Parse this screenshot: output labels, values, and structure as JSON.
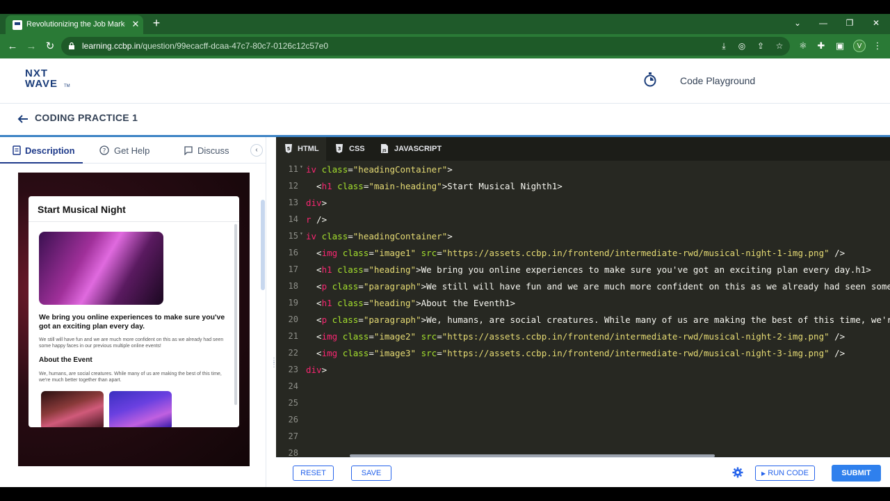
{
  "browser": {
    "tab_title": "Revolutionizing the Job Market |",
    "tab_close": "✕",
    "new_tab": "+",
    "url_host": "learning.ccbp.in",
    "url_path": "/question/99ecacff-dcaa-47c7-80c7-0126c12c57e0",
    "profile_initial": "V",
    "accent": "#2a7a36"
  },
  "header": {
    "logo_line1": "NXT",
    "logo_line2": "WAVE",
    "logo_tm": "TM",
    "playground_label": "Code Playground"
  },
  "practice": {
    "title": "CODING PRACTICE 1"
  },
  "left_tabs": [
    {
      "label": "Description",
      "icon": "document-icon"
    },
    {
      "label": "Get Help",
      "icon": "help-circle-icon"
    },
    {
      "label": "Discuss",
      "icon": "chat-icon"
    }
  ],
  "preview": {
    "title": "Start Musical Night",
    "heading": "We bring you online experiences to make sure you've got an exciting plan every day.",
    "paragraph": "We still will have fun and we are much more confident on this as we already had seen some happy faces in our previous multiple online events!",
    "about_heading": "About the Event",
    "about_paragraph": "We, humans, are social creatures. While many of us are making the best of this time, we're much better together than apart."
  },
  "editor_tabs": [
    {
      "label": "HTML",
      "icon": "html5-icon"
    },
    {
      "label": "CSS",
      "icon": "css3-icon"
    },
    {
      "label": "JAVASCRIPT",
      "icon": "js-file-icon"
    }
  ],
  "code_lines": [
    {
      "n": "11",
      "fold": true,
      "html": "<span class='tag'>iv</span> <span class='attr'>class</span>=<span class='str'>\"headingContainer\"</span>>"
    },
    {
      "n": "12",
      "fold": false,
      "html": "  <<span class='tag'>h1</span> <span class='attr'>class</span>=<span class='str'>\"main-heading\"</span>>Start Musical Night</<span class='tag'>h1</span>>"
    },
    {
      "n": "13",
      "fold": false,
      "html": "<span class='tag'>div</span>>"
    },
    {
      "n": "14",
      "fold": false,
      "html": "<span class='tag'>r</span> />"
    },
    {
      "n": "15",
      "fold": true,
      "html": "<span class='tag'>iv</span> <span class='attr'>class</span>=<span class='str'>\"headingContainer\"</span>>"
    },
    {
      "n": "16",
      "fold": false,
      "html": "  <<span class='tag'>img</span> <span class='attr'>class</span>=<span class='str'>\"image1\"</span> <span class='attr'>src</span>=<span class='str'>\"https://assets.ccbp.in/frontend/intermediate-rwd/musical-night-1-img.png\"</span> />"
    },
    {
      "n": "17",
      "fold": false,
      "html": "  <<span class='tag'>h1</span> <span class='attr'>class</span>=<span class='str'>\"heading\"</span>>We bring you online experiences to make sure you've got an exciting plan every day.</<span class='tag'>h1</span>>"
    },
    {
      "n": "18",
      "fold": false,
      "html": "  <<span class='tag'>p</span> <span class='attr'>class</span>=<span class='str'>\"paragraph\"</span>>We still will have fun and we are much more confident on this as we already had seen some ha"
    },
    {
      "n": "19",
      "fold": false,
      "html": "  <<span class='tag'>h1</span> <span class='attr'>class</span>=<span class='str'>\"heading\"</span>>About the Event</<span class='tag'>h1</span>>"
    },
    {
      "n": "20",
      "fold": false,
      "html": "  <<span class='tag'>p</span> <span class='attr'>class</span>=<span class='str'>\"paragraph\"</span>>We, humans, are social creatures. While many of us are making the best of this time, we're m"
    },
    {
      "n": "21",
      "fold": false,
      "html": "  <<span class='tag'>img</span> <span class='attr'>class</span>=<span class='str'>\"image2\"</span> <span class='attr'>src</span>=<span class='str'>\"https://assets.ccbp.in/frontend/intermediate-rwd/musical-night-2-img.png\"</span> />"
    },
    {
      "n": "22",
      "fold": false,
      "html": "  <<span class='tag'>img</span> <span class='attr'>class</span>=<span class='str'>\"image3\"</span> <span class='attr'>src</span>=<span class='str'>\"https://assets.ccbp.in/frontend/intermediate-rwd/musical-night-3-img.png\"</span> />"
    },
    {
      "n": "23",
      "fold": false,
      "html": "<span class='tag'>div</span>>"
    },
    {
      "n": "24",
      "fold": false,
      "html": ""
    },
    {
      "n": "25",
      "fold": false,
      "html": ""
    },
    {
      "n": "26",
      "fold": false,
      "html": ""
    },
    {
      "n": "27",
      "fold": false,
      "html": ""
    },
    {
      "n": "28",
      "fold": false,
      "html": ""
    }
  ],
  "buttons": {
    "reset": "RESET",
    "save": "SAVE",
    "run_code": "RUN CODE",
    "submit": "SUBMIT",
    "run_icon": "▶"
  }
}
